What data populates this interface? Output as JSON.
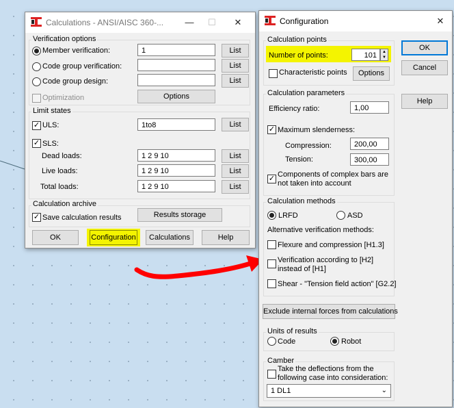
{
  "colors": {
    "highlight": "#f4f400",
    "arrow": "#ff0000",
    "accent": "#0078d7"
  },
  "calculations": {
    "title": "Calculations - ANSI/AISC 360-...",
    "icons": [
      "app-logo-icon",
      "minimize-icon",
      "maximize-icon",
      "close-icon"
    ],
    "verification_options": {
      "label": "Verification options",
      "member_verification": "Member verification:",
      "member_value": "1",
      "code_group_verification": "Code group verification:",
      "code_group_design": "Code group design:",
      "optimization": "Optimization",
      "options_button": "Options",
      "list_button": "List"
    },
    "limit_states": {
      "label": "Limit states",
      "uls": "ULS:",
      "uls_value": "1to8",
      "sls": "SLS:",
      "dead_loads": "Dead loads:",
      "dead_value": "1 2 9 10",
      "live_loads": "Live loads:",
      "live_value": "1 2 9 10",
      "total_loads": "Total loads:",
      "total_value": "1 2 9 10"
    },
    "archive": {
      "label": "Calculation archive",
      "save_results": "Save calculation results",
      "results_storage": "Results storage"
    },
    "buttons": {
      "ok": "OK",
      "configuration": "Configuration",
      "calculations": "Calculations",
      "help": "Help"
    }
  },
  "configuration": {
    "title": "Configuration",
    "calculation_points": {
      "label": "Calculation points",
      "number_of_points": "Number of points:",
      "points_value": "101",
      "characteristic_points": "Characteristic points",
      "options_button": "Options"
    },
    "parameters": {
      "label": "Calculation parameters",
      "efficiency_ratio": "Efficiency ratio:",
      "efficiency_value": "1,00",
      "maximum_slenderness": "Maximum slenderness:",
      "compression": "Compression:",
      "compression_value": "200,00",
      "tension": "Tension:",
      "tension_value": "300,00",
      "complex_bars_1": "Components of complex bars are",
      "complex_bars_2": "not taken into account"
    },
    "methods": {
      "label": "Calculation methods",
      "lrfd": "LRFD",
      "asd": "ASD",
      "alternative": "Alternative verification methods:",
      "flexure": "Flexure and compression [H1.3]",
      "verification_1": "Verification according to [H2]",
      "verification_2": "instead of [H1]",
      "shear": "Shear - \"Tension field action\" [G2.2]"
    },
    "exclude_button": "Exclude internal forces from calculations",
    "units": {
      "label": "Units of results",
      "code": "Code",
      "robot": "Robot"
    },
    "camber": {
      "label": "Camber",
      "text_1": "Take the deflections from the",
      "text_2": "following case into consideration:",
      "case_value": "1  DL1"
    },
    "buttons": {
      "ok": "OK",
      "cancel": "Cancel",
      "help": "Help"
    }
  }
}
